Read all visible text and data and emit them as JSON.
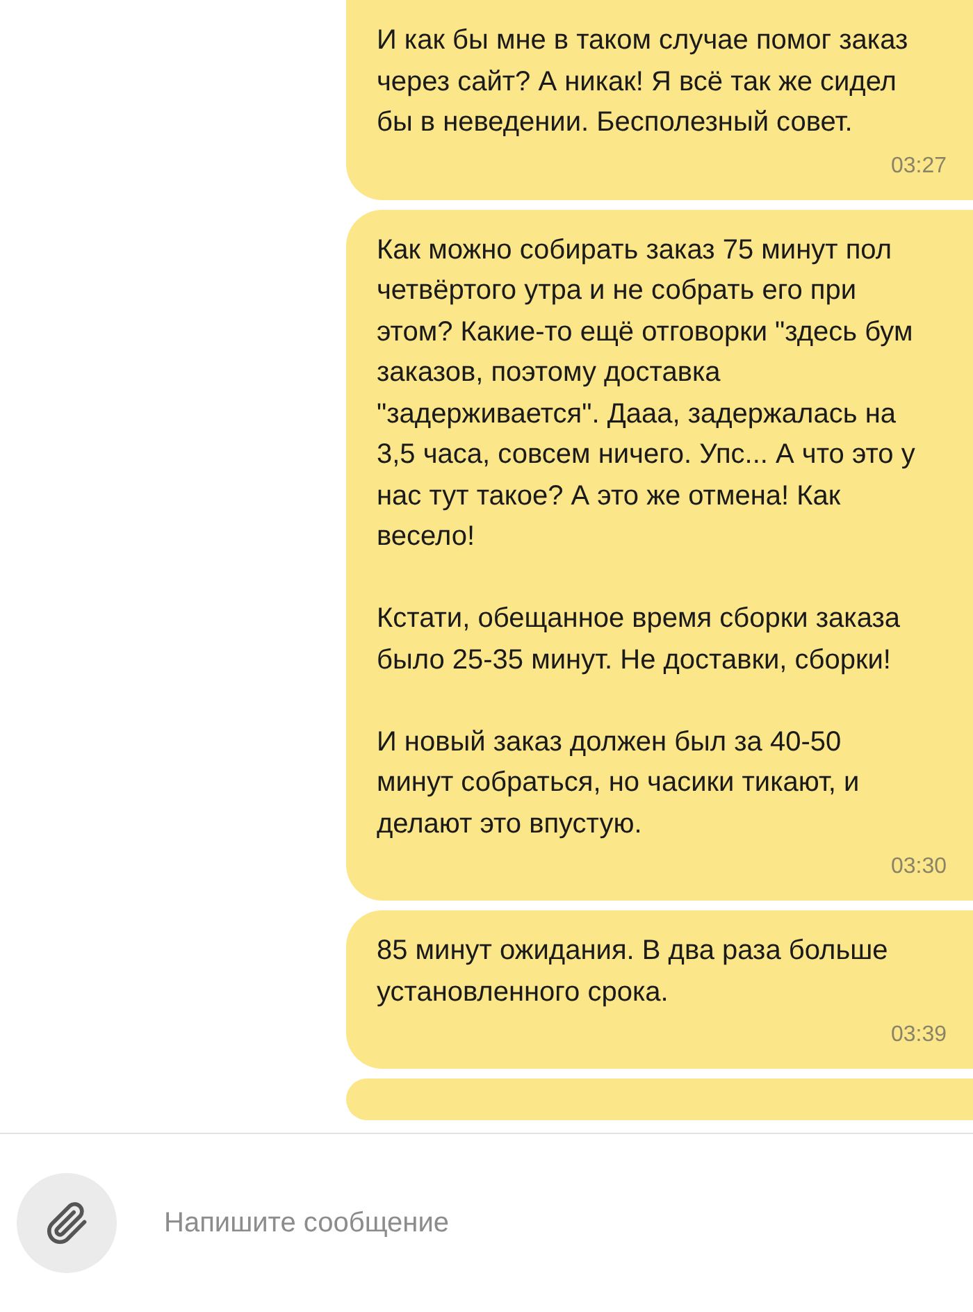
{
  "messages": [
    {
      "kind": "text",
      "paragraphs": [
        "И как бы мне в таком случае помог заказ через сайт? А никак! Я всё так же сидел бы в неведении. Бесполезный совет."
      ],
      "time": "03:27"
    },
    {
      "kind": "text",
      "paragraphs": [
        "Как можно собирать заказ 75 минут пол четвёртого утра и не собрать его при этом? Какие-то ещё отговорки \"здесь бум заказов, поэтому доставка \"задерживается\". Дааа, задержалась на 3,5 часа, совсем ничего. Упс... А что это у нас тут такое? А это же отмена! Как весело!",
        "Кстати, обещанное время сборки заказа было 25-35 минут. Не доставки, сборки!",
        "И новый заказ должен был за 40-50 минут собраться, но часики тикают, и делают это впустую."
      ],
      "time": "03:30"
    },
    {
      "kind": "text",
      "paragraphs": [
        "85 минут ожидания. В два раза больше установленного срока."
      ],
      "time": "03:39"
    },
    {
      "kind": "partial"
    }
  ],
  "composer": {
    "placeholder": "Напишите сообщение"
  }
}
